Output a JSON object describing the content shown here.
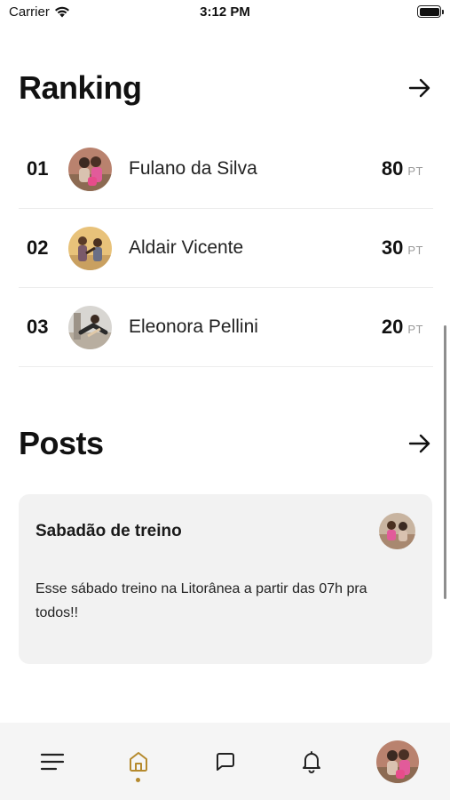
{
  "status_bar": {
    "carrier": "Carrier",
    "time": "3:12 PM"
  },
  "ranking": {
    "title": "Ranking",
    "entries": [
      {
        "position": "01",
        "name": "Fulano da Silva",
        "points": "80",
        "unit": "PT"
      },
      {
        "position": "02",
        "name": "Aldair Vicente",
        "points": "30",
        "unit": "PT"
      },
      {
        "position": "03",
        "name": "Eleonora Pellini",
        "points": "20",
        "unit": "PT"
      }
    ]
  },
  "posts": {
    "title": "Posts",
    "items": [
      {
        "title": "Sabadão de treino",
        "body": "Esse sábado treino na Litorânea a partir das 07h pra todos!!"
      }
    ]
  },
  "tab_bar": {
    "items": [
      "menu-icon",
      "home-icon",
      "chat-icon",
      "bell-icon",
      "profile-avatar"
    ],
    "active_index": 1,
    "accent_color": "#b58a2e"
  },
  "colors": {
    "card_background": "#f2f2f2",
    "tab_bar_background": "#f5f5f5",
    "unit_text": "#999999"
  }
}
